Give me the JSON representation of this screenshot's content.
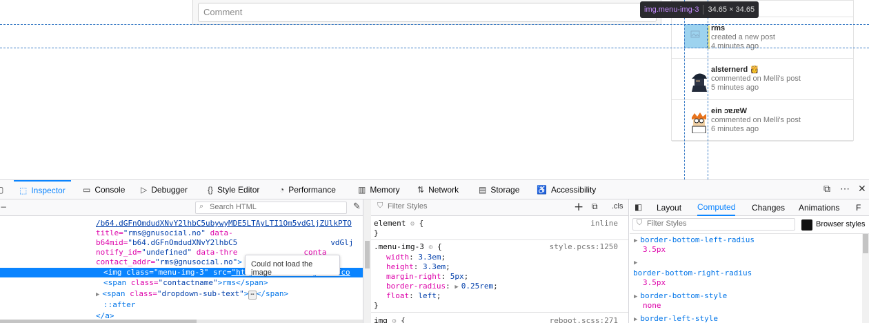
{
  "page": {
    "comment_placeholder": "Comment",
    "notifications": [
      {
        "name": "rms",
        "desc": "created a new post",
        "time": "4 minutes ago",
        "avatar": "broken-image-icon"
      },
      {
        "name": "alsternerd 👸",
        "desc": "commented on Melli's post",
        "time": "5 minutes ago",
        "avatar": "avatar-hat-person"
      },
      {
        "name": "ein ɔɐɹɐW",
        "desc": "commented on Melli's post",
        "time": "6 minutes ago",
        "avatar": "avatar-cartoon-scientist"
      }
    ],
    "hover_tooltip": {
      "tag": "img",
      "cls": ".menu-img-3",
      "dims": "34.65 × 34.65"
    }
  },
  "devtools": {
    "tabs": [
      {
        "label": "Inspector",
        "icon": "inspector-icon"
      },
      {
        "label": "Console",
        "icon": "console-icon"
      },
      {
        "label": "Debugger",
        "icon": "debugger-icon"
      },
      {
        "label": "Style Editor",
        "icon": "style-editor-icon"
      },
      {
        "label": "Performance",
        "icon": "performance-icon"
      },
      {
        "label": "Memory",
        "icon": "memory-icon"
      },
      {
        "label": "Network",
        "icon": "network-icon"
      },
      {
        "label": "Storage",
        "icon": "storage-icon"
      },
      {
        "label": "Accessibility",
        "icon": "accessibility-icon"
      }
    ],
    "search_html_placeholder": "Search HTML",
    "filter_styles_placeholder": "Filter Styles",
    "cls_label": ".cls",
    "html_lines": {
      "l1": "/b64.dGFnOmdudXNvY2lhbC5ubywyMDE5LTAyLTI1Om5vdGljZUlkPTO",
      "l2a": "title=",
      "l2b": "\"rms@gnusocial.no\"",
      "l2c": " data-",
      "l3a": "b64mid=",
      "l3b": "\"b64.dGFnOmdudXNvY2lhbC5",
      "l3c": "vdGlj",
      "l4a": "notify_id=",
      "l4b": "\"undefined\"",
      "l4c": " data-thre",
      "l4d": "conta",
      "l5a": "contact_addr=",
      "l5b": "\"rms@gnusocial.no\"",
      "l5c": "> ",
      "l5badge": "event",
      "sel_a": "<img ",
      "sel_b": "class=",
      "sel_c": "\"menu-img-3\"",
      "sel_d": " src=",
      "sel_e": "\"https://ussr.win/photo/co",
      "l7a": "<span ",
      "l7b": "class=",
      "l7c": "\"contactname\"",
      "l7d": ">rms</span>",
      "l8a": "<span ",
      "l8b": "class=",
      "l8c": "\"dropdown-sub-text\"",
      "l8d": ">",
      "l8e": "</span>",
      "l9": "::after",
      "l10": "</a>"
    },
    "img_tooltip": "Could not load the image",
    "rules": {
      "element_sel": "element",
      "element_src": "inline",
      "rule_sel": ".menu-img-3",
      "rule_src": "style.pcss:1250",
      "decls": [
        {
          "prop": "width",
          "val": "3.3em"
        },
        {
          "prop": "height",
          "val": "3.3em"
        },
        {
          "prop": "margin-right",
          "val": "5px"
        },
        {
          "prop": "border-radius",
          "val": "0.25rem"
        },
        {
          "prop": "float",
          "val": "left"
        }
      ],
      "next_sel": "img",
      "next_src": "reboot.scss:271"
    },
    "layout_tabs": [
      "Layout",
      "Computed",
      "Changes",
      "Animations",
      "F"
    ],
    "browser_styles_label": "Browser styles",
    "computed": [
      {
        "prop": "border-bottom-left-radius",
        "val": "3.5px"
      },
      {
        "prop": "border-bottom-right-radius",
        "val": "3.5px"
      },
      {
        "prop": "border-bottom-style",
        "val": "none"
      },
      {
        "prop": "border-left-style",
        "val": ""
      }
    ]
  }
}
